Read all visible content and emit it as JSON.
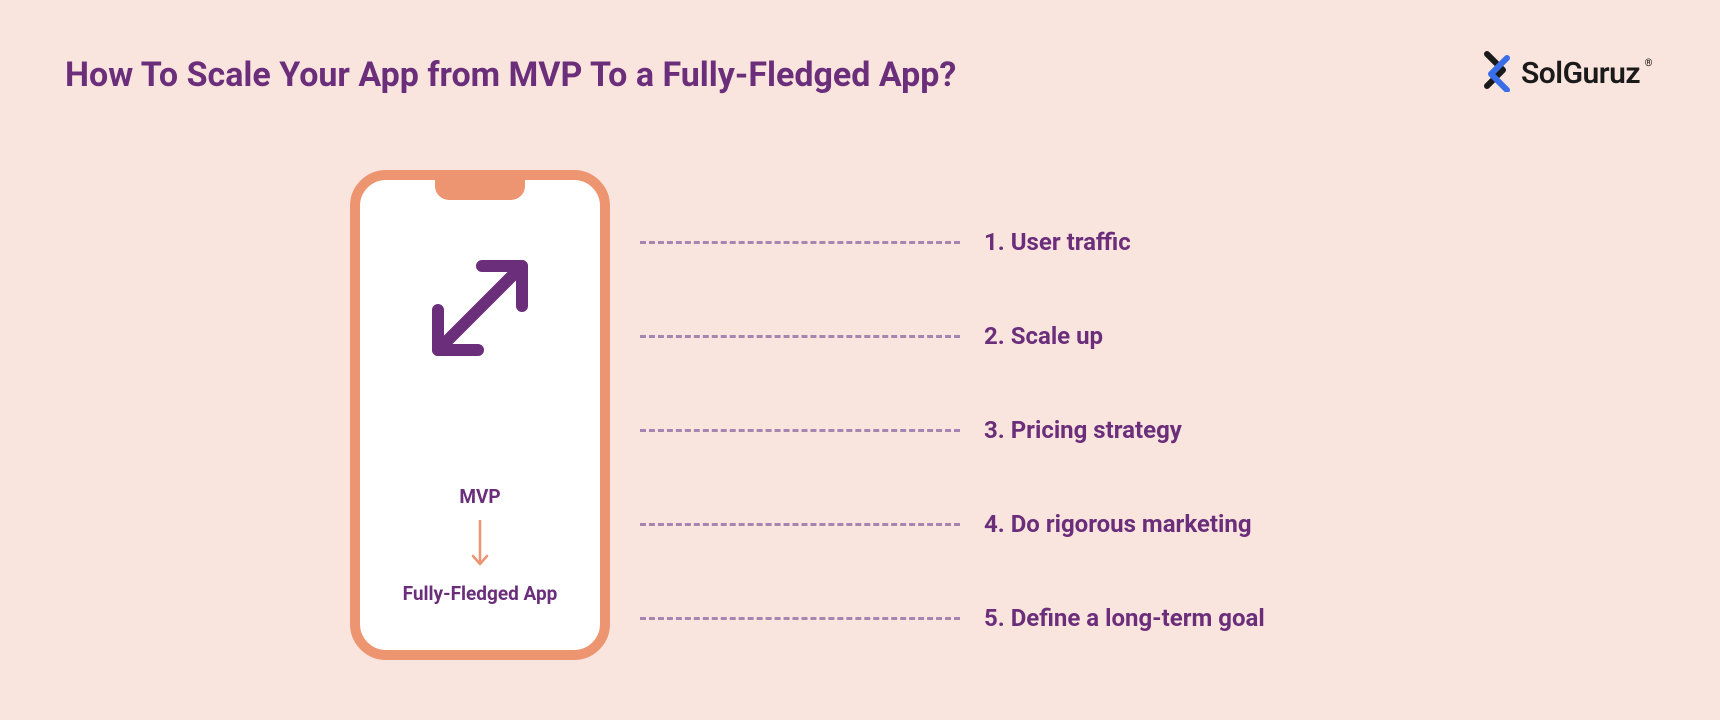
{
  "title": "How To Scale Your App from MVP To a Fully-Fledged App?",
  "brand": {
    "name": "SolGuruz",
    "trademark": "®"
  },
  "phone": {
    "top_label": "MVP",
    "bottom_label": "Fully-Fledged App"
  },
  "items": [
    {
      "num": "1.",
      "label": "User traffic"
    },
    {
      "num": "2.",
      "label": "Scale up"
    },
    {
      "num": "3.",
      "label": "Pricing strategy"
    },
    {
      "num": "4.",
      "label": "Do rigorous marketing"
    },
    {
      "num": "5.",
      "label": "Define a long-term goal"
    }
  ],
  "colors": {
    "background": "#fae5de",
    "accent_purple": "#6b2e7a",
    "accent_orange": "#ed9570",
    "dash": "#a686b0"
  }
}
